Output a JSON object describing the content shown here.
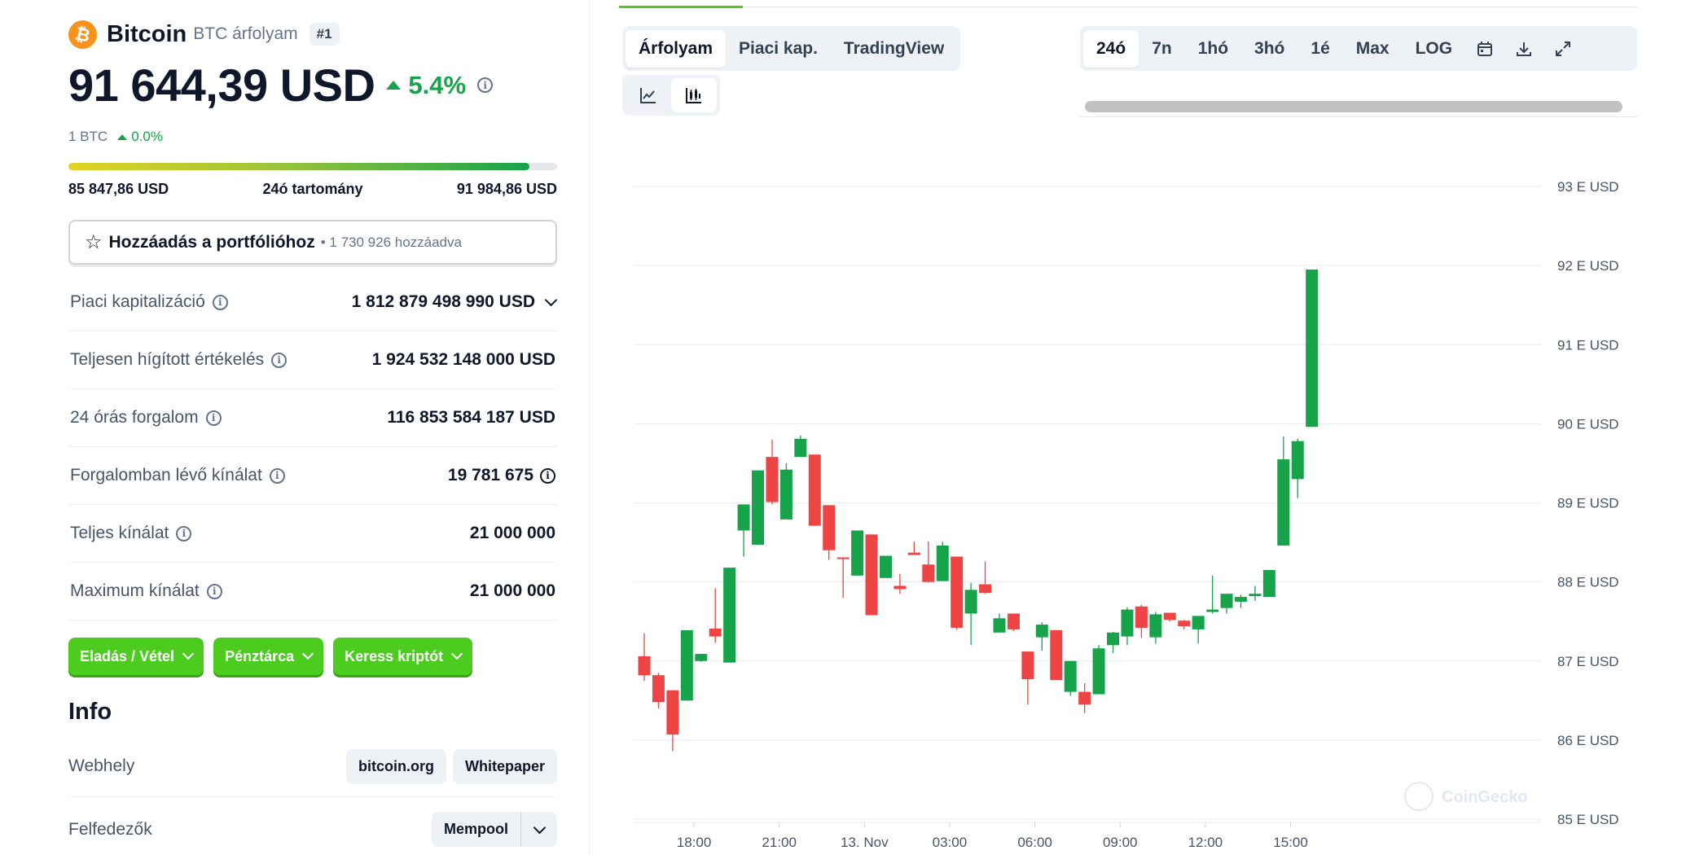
{
  "coin": {
    "logo_glyph": "₿",
    "name": "Bitcoin",
    "subtitle": "BTC árfolyam",
    "rank": "#1",
    "price": "91 644,39 USD",
    "change_24h": "5.4%",
    "btc_label": "1 BTC",
    "btc_change": "0.0%",
    "colors": {
      "up": "#16a34a",
      "down": "#ef4444",
      "accent": "#4bcc1f",
      "logo": "#f7931a"
    }
  },
  "range": {
    "low": "85 847,86 USD",
    "label": "24ó tartomány",
    "high": "91 984,86 USD",
    "fill_fraction": 0.944
  },
  "portfolio": {
    "icon": "star-icon",
    "label": "Hozzáadás a portfólióhoz",
    "count": "1 730 926 hozzáadva"
  },
  "stats": [
    {
      "label": "Piaci kapitalizáció",
      "value": "1 812 879 498 990 USD",
      "expand": true,
      "value_info": false
    },
    {
      "label": "Teljesen hígított értékelés",
      "value": "1 924 532 148 000 USD",
      "expand": false,
      "value_info": false
    },
    {
      "label": "24 órás forgalom",
      "value": "116 853 584 187 USD",
      "expand": false,
      "value_info": false
    },
    {
      "label": "Forgalomban lévő kínálat",
      "value": "19 781 675",
      "expand": false,
      "value_info": true
    },
    {
      "label": "Teljes kínálat",
      "value": "21 000 000",
      "expand": false,
      "value_info": false
    },
    {
      "label": "Maximum kínálat",
      "value": "21 000 000",
      "expand": false,
      "value_info": false
    }
  ],
  "actions": [
    "Eladás / Vétel",
    "Pénztárca",
    "Keress kriptót"
  ],
  "info": {
    "heading": "Info",
    "website_label": "Webhely",
    "website_links": [
      "bitcoin.org",
      "Whitepaper"
    ],
    "explorers_label": "Felfedezők",
    "explorer": "Mempool"
  },
  "chart_tabs": [
    "Árfolyam",
    "Piaci kap.",
    "TradingView"
  ],
  "active_chart_tab": 0,
  "timeframes": [
    "24ó",
    "7n",
    "1hó",
    "3hó",
    "1é",
    "Max",
    "LOG"
  ],
  "active_timeframe": 0,
  "toolbar_icons": [
    "calendar-icon",
    "download-icon",
    "fullscreen-icon"
  ],
  "chart_types": [
    "line-chart-icon",
    "candlestick-icon"
  ],
  "active_chart_type": 1,
  "watermark": "CoinGecko",
  "chart_data": {
    "type": "candlestick",
    "y_unit": "USD",
    "ylim": [
      85000,
      93000
    ],
    "y_ticks": [
      93000,
      92000,
      91000,
      90000,
      89000,
      88000,
      87000,
      86000,
      85000
    ],
    "y_tick_labels": [
      "93 E USD",
      "92 E USD",
      "91 E USD",
      "90 E USD",
      "89 E USD",
      "88 E USD",
      "87 E USD",
      "86 E USD",
      "85 E USD"
    ],
    "x_tick_labels": [
      "18:00",
      "21:00",
      "13. Nov",
      "03:00",
      "06:00",
      "09:00",
      "12:00",
      "15:00"
    ],
    "x_tick_candle_index": [
      3.5,
      9.5,
      15.5,
      21.5,
      27.5,
      33.5,
      39.5,
      45.5
    ],
    "grid": true,
    "candles": [
      {
        "o": 87060,
        "h": 87350,
        "l": 86750,
        "c": 86820
      },
      {
        "o": 86820,
        "h": 86850,
        "l": 86400,
        "c": 86480
      },
      {
        "o": 86630,
        "h": 86630,
        "l": 85860,
        "c": 86070
      },
      {
        "o": 86500,
        "h": 87390,
        "l": 86500,
        "c": 87390
      },
      {
        "o": 87000,
        "h": 87090,
        "l": 86990,
        "c": 87090
      },
      {
        "o": 87410,
        "h": 87920,
        "l": 87230,
        "c": 87310
      },
      {
        "o": 86980,
        "h": 88180,
        "l": 86980,
        "c": 88180
      },
      {
        "o": 88650,
        "h": 88650,
        "l": 88320,
        "c": 88980
      },
      {
        "o": 88470,
        "h": 89410,
        "l": 88470,
        "c": 89410
      },
      {
        "o": 89580,
        "h": 89800,
        "l": 88980,
        "c": 89010
      },
      {
        "o": 88790,
        "h": 89500,
        "l": 88790,
        "c": 89420
      },
      {
        "o": 89580,
        "h": 89850,
        "l": 89580,
        "c": 89810
      },
      {
        "o": 89610,
        "h": 89610,
        "l": 88710,
        "c": 88710
      },
      {
        "o": 88970,
        "h": 88970,
        "l": 88280,
        "c": 88400
      },
      {
        "o": 88310,
        "h": 88310,
        "l": 87800,
        "c": 88300
      },
      {
        "o": 88080,
        "h": 88650,
        "l": 88080,
        "c": 88650
      },
      {
        "o": 88600,
        "h": 88600,
        "l": 87580,
        "c": 87580
      },
      {
        "o": 88050,
        "h": 88330,
        "l": 88050,
        "c": 88330
      },
      {
        "o": 87950,
        "h": 88100,
        "l": 87850,
        "c": 87910
      },
      {
        "o": 88370,
        "h": 88510,
        "l": 88350,
        "c": 88340
      },
      {
        "o": 88220,
        "h": 88510,
        "l": 87990,
        "c": 88000
      },
      {
        "o": 88010,
        "h": 88510,
        "l": 88010,
        "c": 88460
      },
      {
        "o": 88320,
        "h": 88320,
        "l": 87400,
        "c": 87420
      },
      {
        "o": 87600,
        "h": 87990,
        "l": 87200,
        "c": 87900
      },
      {
        "o": 87970,
        "h": 88260,
        "l": 87850,
        "c": 87860
      },
      {
        "o": 87360,
        "h": 87600,
        "l": 87360,
        "c": 87540
      },
      {
        "o": 87600,
        "h": 87600,
        "l": 87380,
        "c": 87400
      },
      {
        "o": 87120,
        "h": 87120,
        "l": 86450,
        "c": 86770
      },
      {
        "o": 87300,
        "h": 87490,
        "l": 87130,
        "c": 87460
      },
      {
        "o": 87390,
        "h": 87390,
        "l": 86780,
        "c": 86760
      },
      {
        "o": 86610,
        "h": 87000,
        "l": 86560,
        "c": 87000
      },
      {
        "o": 86610,
        "h": 86720,
        "l": 86340,
        "c": 86450
      },
      {
        "o": 86580,
        "h": 87200,
        "l": 86580,
        "c": 87160
      },
      {
        "o": 87200,
        "h": 87370,
        "l": 87100,
        "c": 87360
      },
      {
        "o": 87310,
        "h": 87680,
        "l": 87200,
        "c": 87650
      },
      {
        "o": 87690,
        "h": 87710,
        "l": 87290,
        "c": 87420
      },
      {
        "o": 87300,
        "h": 87620,
        "l": 87220,
        "c": 87590
      },
      {
        "o": 87610,
        "h": 87610,
        "l": 87500,
        "c": 87520
      },
      {
        "o": 87510,
        "h": 87520,
        "l": 87400,
        "c": 87440
      },
      {
        "o": 87400,
        "h": 87560,
        "l": 87220,
        "c": 87570
      },
      {
        "o": 87620,
        "h": 88080,
        "l": 87600,
        "c": 87650
      },
      {
        "o": 87670,
        "h": 87850,
        "l": 87600,
        "c": 87850
      },
      {
        "o": 87750,
        "h": 87840,
        "l": 87670,
        "c": 87810
      },
      {
        "o": 87820,
        "h": 87950,
        "l": 87760,
        "c": 87850
      },
      {
        "o": 87810,
        "h": 88140,
        "l": 87810,
        "c": 88150
      },
      {
        "o": 88460,
        "h": 89840,
        "l": 88460,
        "c": 89550
      },
      {
        "o": 89300,
        "h": 89810,
        "l": 89060,
        "c": 89780
      },
      {
        "o": 89960,
        "h": 91950,
        "l": 89960,
        "c": 91950
      }
    ]
  }
}
